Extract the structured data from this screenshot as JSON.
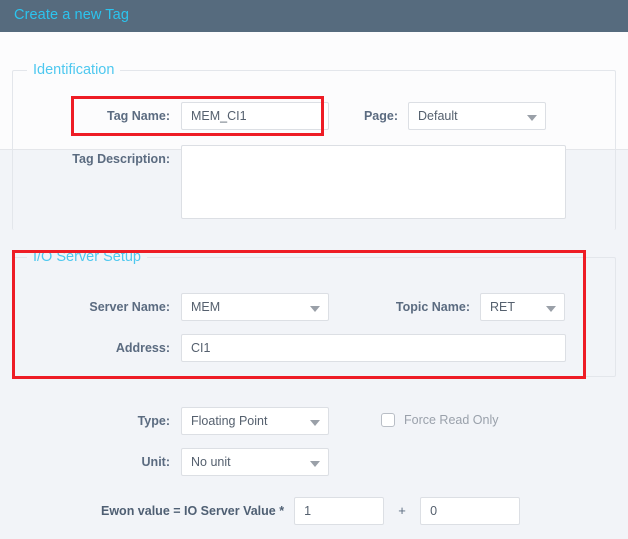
{
  "window": {
    "title": "Create a new Tag",
    "title_color": "#2bc4ef",
    "titlebar_color": "#566b7e"
  },
  "sections": {
    "identification": {
      "legend": "Identification",
      "legend_color": "#4ec8ef",
      "tag_name": {
        "label": "Tag Name:",
        "value": "MEM_CI1",
        "placeholder": ""
      },
      "page": {
        "label": "Page:",
        "value": "Default",
        "options": [
          "Default"
        ]
      },
      "tag_description": {
        "label": "Tag Description:",
        "value": "",
        "placeholder": ""
      }
    },
    "io_server_setup": {
      "legend": "I/O Server Setup",
      "legend_color": "#4ec8ef",
      "server_name": {
        "label": "Server Name:",
        "value": "MEM",
        "options": [
          "MEM"
        ]
      },
      "topic_name": {
        "label": "Topic Name:",
        "value": "RET",
        "options": [
          "RET"
        ]
      },
      "address": {
        "label": "Address:",
        "value": "CI1",
        "placeholder": ""
      }
    },
    "value_setup": {
      "type": {
        "label": "Type:",
        "value": "Floating Point",
        "options": [
          "Floating Point"
        ]
      },
      "unit": {
        "label": "Unit:",
        "value": "No unit",
        "options": [
          "No unit"
        ]
      },
      "force_read_only": {
        "label": "Force Read Only",
        "checked": false
      },
      "formula": {
        "label": "Ewon value = IO Server Value *",
        "multiplier": "1",
        "operator": "+",
        "offset": "0"
      }
    }
  },
  "annotations": {
    "color": "#ee1c25",
    "boxes": [
      {
        "name": "tag-name-highlight"
      },
      {
        "name": "io-server-setup-highlight"
      }
    ]
  },
  "icons": {
    "dropdown": "chevron-down-icon",
    "checkbox": "checkbox-icon"
  }
}
